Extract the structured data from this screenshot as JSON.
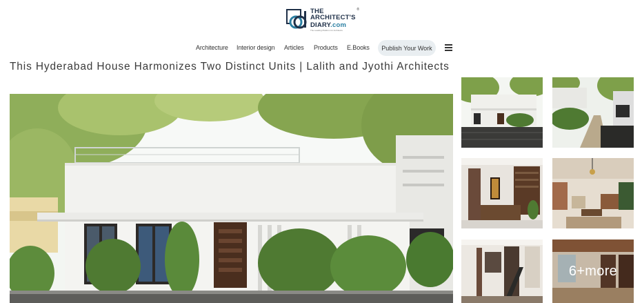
{
  "logo": {
    "line1": "THE ARCHITECT'S",
    "line2": "DIARY",
    "line2_suffix": ".com",
    "reg_mark": "®",
    "tagline": "The Leading Platform for Architects"
  },
  "nav": {
    "items": [
      {
        "label": "Architecture"
      },
      {
        "label": "Interior design"
      },
      {
        "label": "Articles"
      },
      {
        "label": "Products"
      },
      {
        "label": "E.Books"
      }
    ],
    "publish_label": "Publish Your Work",
    "menu_icon": "hamburger-menu-icon"
  },
  "article": {
    "title": "This Hyderabad House Harmonizes Two Distinct Units | Lalith and Jyothi Architects"
  },
  "gallery": {
    "main_image": "house-exterior-photo",
    "thumbnails": [
      {
        "image": "house-front-exterior-photo"
      },
      {
        "image": "side-courtyard-photo"
      },
      {
        "image": "living-room-interior-photo"
      },
      {
        "image": "seating-area-interior-photo"
      },
      {
        "image": "staircase-interior-photo"
      },
      {
        "image": "bedroom-interior-photo",
        "overlay": "6+more"
      }
    ]
  },
  "colors": {
    "brand_dark": "#1f3048",
    "brand_accent": "#2c80a3",
    "publish_button_bg": "#e9eef1"
  }
}
